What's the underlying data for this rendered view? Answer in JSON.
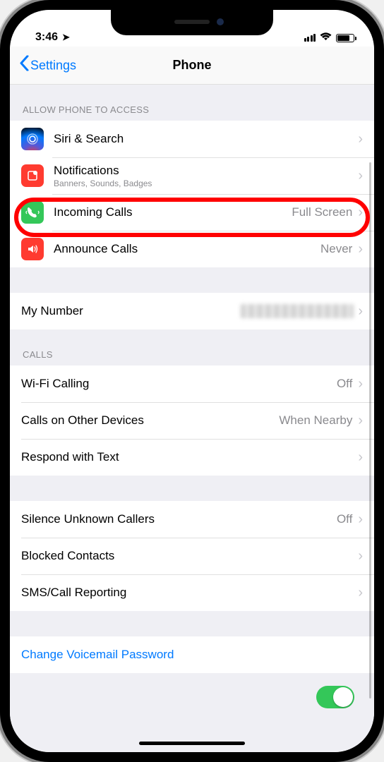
{
  "status": {
    "time": "3:46",
    "loc_arrow": "➤"
  },
  "nav": {
    "back": "Settings",
    "title": "Phone"
  },
  "sections": {
    "access_header": "ALLOW PHONE TO ACCESS",
    "siri": "Siri & Search",
    "notifications": "Notifications",
    "notifications_sub": "Banners, Sounds, Badges",
    "incoming": "Incoming Calls",
    "incoming_value": "Full Screen",
    "announce": "Announce Calls",
    "announce_value": "Never",
    "my_number": "My Number",
    "calls_header": "CALLS",
    "wifi_calling": "Wi-Fi Calling",
    "wifi_calling_value": "Off",
    "other_devices": "Calls on Other Devices",
    "other_devices_value": "When Nearby",
    "respond": "Respond with Text",
    "silence": "Silence Unknown Callers",
    "silence_value": "Off",
    "blocked": "Blocked Contacts",
    "sms_report": "SMS/Call Reporting",
    "voicemail": "Change Voicemail Password"
  }
}
